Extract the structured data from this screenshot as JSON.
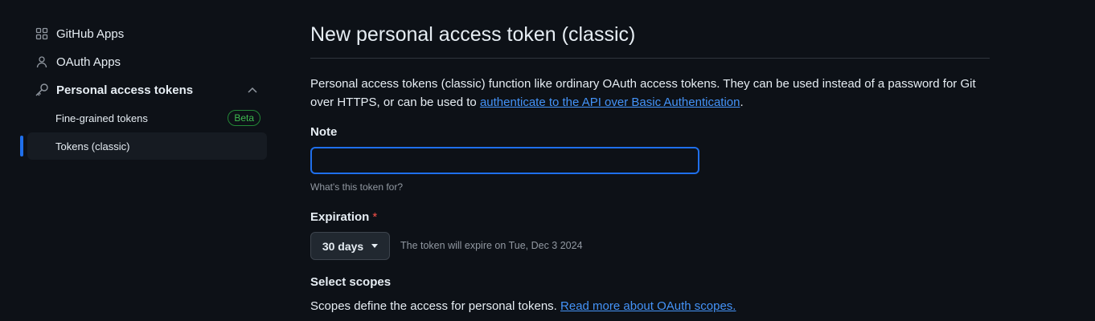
{
  "sidebar": {
    "items": [
      {
        "label": "GitHub Apps",
        "icon": "apps-grid-icon"
      },
      {
        "label": "OAuth Apps",
        "icon": "person-icon"
      },
      {
        "label": "Personal access tokens",
        "icon": "key-icon",
        "expanded": true
      }
    ],
    "subitems": [
      {
        "label": "Fine-grained tokens",
        "badge": "Beta"
      },
      {
        "label": "Tokens (classic)",
        "active": true
      }
    ]
  },
  "main": {
    "title": "New personal access token (classic)",
    "description_prefix": "Personal access tokens (classic) function like ordinary OAuth access tokens. They can be used instead of a password for Git over HTTPS, or can be used to ",
    "description_link": "authenticate to the API over Basic Authentication",
    "description_suffix": ".",
    "note": {
      "label": "Note",
      "value": "",
      "placeholder": "",
      "hint": "What's this token for?"
    },
    "expiration": {
      "label": "Expiration",
      "required_mark": "*",
      "selected": "30 days",
      "info": "The token will expire on Tue, Dec 3 2024"
    },
    "scopes": {
      "label": "Select scopes",
      "description": "Scopes define the access for personal tokens. ",
      "link": "Read more about OAuth scopes."
    }
  },
  "colors": {
    "background": "#0d1117",
    "accent": "#1f6feb",
    "link": "#4493f8",
    "beta": "#3fb950",
    "required": "#f85149"
  }
}
